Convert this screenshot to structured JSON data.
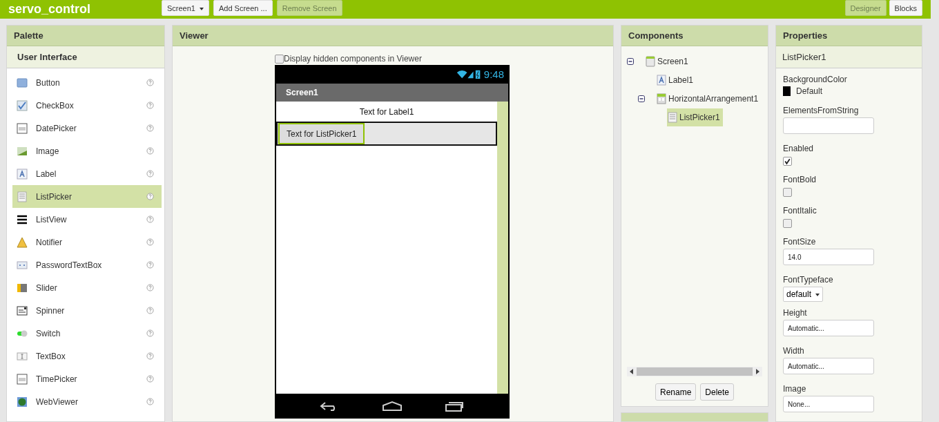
{
  "topbar": {
    "title": "servo_control",
    "buttons": [
      {
        "label": "Screen1",
        "kind": "dropdown",
        "disabled": false
      },
      {
        "label": "Add Screen ...",
        "kind": "plain",
        "disabled": false
      },
      {
        "label": "Remove Screen",
        "kind": "plain",
        "disabled": true
      }
    ],
    "modes": [
      {
        "label": "Designer",
        "selected": true
      },
      {
        "label": "Blocks",
        "selected": false
      }
    ]
  },
  "palette": {
    "title": "Palette",
    "category": "User Interface",
    "items": [
      {
        "label": "Button",
        "selected": false
      },
      {
        "label": "CheckBox",
        "selected": false
      },
      {
        "label": "DatePicker",
        "selected": false
      },
      {
        "label": "Image",
        "selected": false
      },
      {
        "label": "Label",
        "selected": false
      },
      {
        "label": "ListPicker",
        "selected": true
      },
      {
        "label": "ListView",
        "selected": false
      },
      {
        "label": "Notifier",
        "selected": false
      },
      {
        "label": "PasswordTextBox",
        "selected": false
      },
      {
        "label": "Slider",
        "selected": false
      },
      {
        "label": "Spinner",
        "selected": false
      },
      {
        "label": "Switch",
        "selected": false
      },
      {
        "label": "TextBox",
        "selected": false
      },
      {
        "label": "TimePicker",
        "selected": false
      },
      {
        "label": "WebViewer",
        "selected": false
      }
    ]
  },
  "viewer": {
    "title": "Viewer",
    "hidden_toggle": {
      "label": "Display hidden components in Viewer",
      "checked": false
    },
    "phone": {
      "time": "9:48",
      "screen_title": "Screen1",
      "label_text": "Text for Label1",
      "listpicker_text": "Text for ListPicker1",
      "listpicker_selected": true
    }
  },
  "components": {
    "title": "Components",
    "tree": [
      {
        "label": "Screen1",
        "expanded": true,
        "selected": false,
        "children": [
          {
            "label": "Label1",
            "selected": false
          },
          {
            "label": "HorizontalArrangement1",
            "expanded": true,
            "selected": false,
            "children": [
              {
                "label": "ListPicker1",
                "selected": true
              }
            ]
          }
        ]
      }
    ],
    "buttons": [
      "Rename",
      "Delete"
    ]
  },
  "properties": {
    "title": "Properties",
    "component": "ListPicker1",
    "items": [
      {
        "kind": "color",
        "label": "BackgroundColor",
        "value": "Default",
        "color": "#000000"
      },
      {
        "kind": "text",
        "label": "ElementsFromString"
      },
      {
        "kind": "checkbox",
        "label": "Enabled",
        "checked": true
      },
      {
        "kind": "checkbox",
        "label": "FontBold",
        "checked": false
      },
      {
        "kind": "checkbox",
        "label": "FontItalic",
        "checked": false
      },
      {
        "kind": "text",
        "label": "FontSize",
        "value": "14.0"
      },
      {
        "kind": "dropdown",
        "label": "FontTypeface",
        "value": "default"
      },
      {
        "kind": "text",
        "label": "Height",
        "value": "Automatic..."
      },
      {
        "kind": "text",
        "label": "Width",
        "value": "Automatic..."
      },
      {
        "kind": "text",
        "label": "Image",
        "value": "None..."
      }
    ]
  }
}
